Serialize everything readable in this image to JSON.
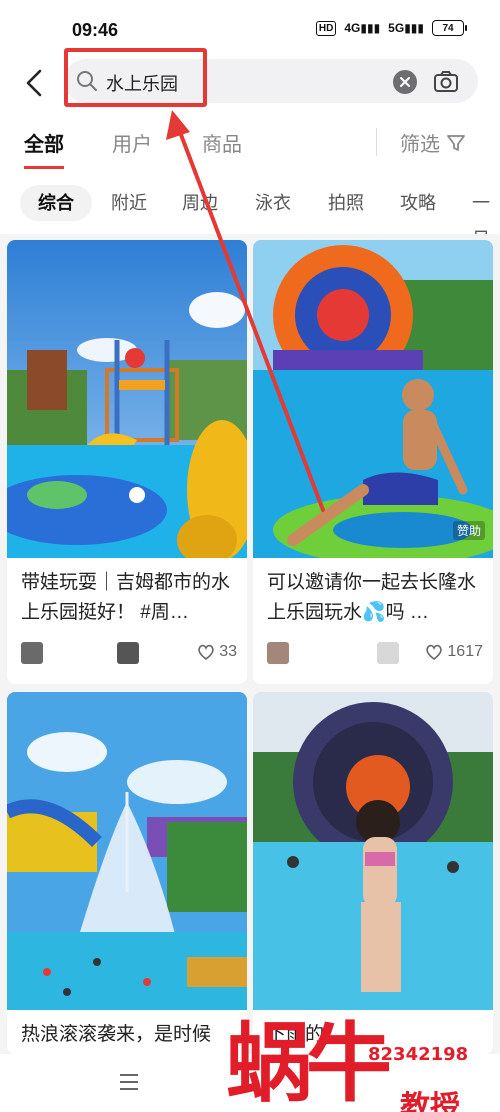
{
  "status": {
    "time": "09:46",
    "hd": "HD",
    "net1": "4G",
    "net2": "5G",
    "battery": "74"
  },
  "search": {
    "query": "水上乐园"
  },
  "tabs": [
    {
      "label": "全部"
    },
    {
      "label": "用户"
    },
    {
      "label": "商品"
    }
  ],
  "filter_label": "筛选",
  "chips": [
    "综合",
    "附近",
    "周边",
    "泳衣",
    "拍照",
    "攻略",
    "一日"
  ],
  "cards": [
    {
      "title": "带娃玩耍｜吉姆都市的水上乐园挺好！ #周…",
      "likes": "33"
    },
    {
      "title": "可以邀请你一起去长隆水上乐园玩水💦吗 …",
      "likes": "1617",
      "sponsor": "赞助"
    },
    {
      "title": "热浪滚滚袭来，是时候"
    },
    {
      "title": "下雨的"
    }
  ],
  "watermark": {
    "main": "蜗牛",
    "sub": "教授",
    "phone": "82342198"
  },
  "colors": {
    "accent": "#e53935",
    "highlight": "#e53935"
  }
}
